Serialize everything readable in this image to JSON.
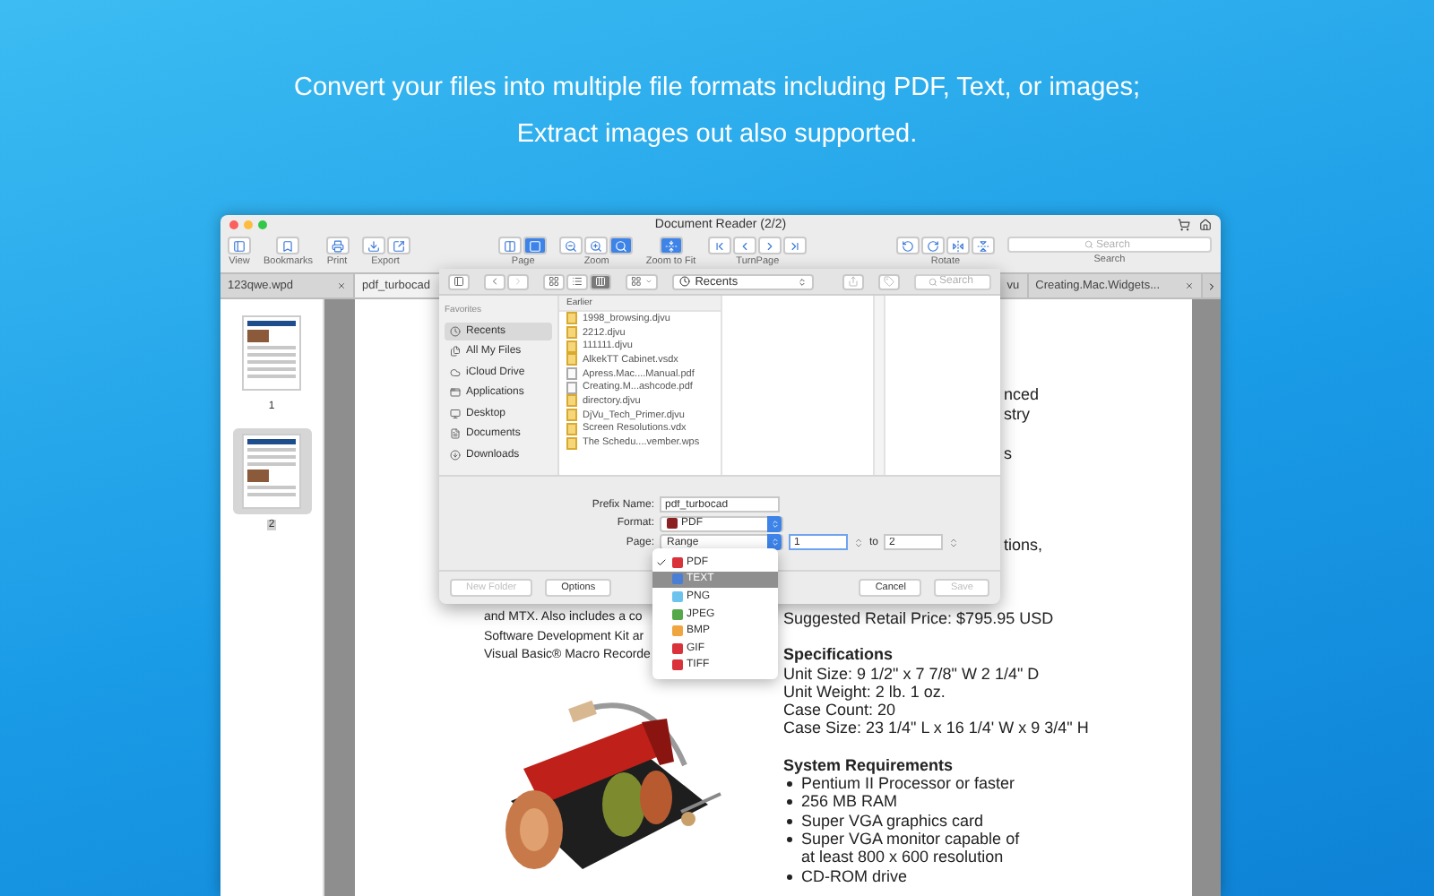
{
  "headline": [
    "Convert your files into multiple file formats including PDF, Text, or images;",
    "Extract images out also supported."
  ],
  "window": {
    "title": "Document Reader (2/2)"
  },
  "toolbar": {
    "groups": [
      {
        "label": "View",
        "buttons": [
          {
            "selected": false
          }
        ]
      },
      {
        "label": "Bookmarks",
        "buttons": [
          {
            "selected": false
          }
        ]
      },
      {
        "label": "Print",
        "buttons": [
          {
            "selected": false
          }
        ]
      },
      {
        "label": "Export",
        "buttons": [
          {
            "selected": false
          },
          {
            "selected": false
          }
        ]
      },
      {
        "label": "Page",
        "buttons": [
          {
            "selected": false
          },
          {
            "selected": true
          }
        ]
      },
      {
        "label": "Zoom",
        "buttons": [
          {
            "selected": false
          },
          {
            "selected": false
          },
          {
            "selected": true
          }
        ]
      },
      {
        "label": "Zoom to Fit",
        "buttons": [
          {
            "selected": true
          }
        ]
      },
      {
        "label": "TurnPage",
        "buttons": [
          {
            "selected": false
          },
          {
            "selected": false
          },
          {
            "selected": false
          },
          {
            "selected": false
          }
        ]
      },
      {
        "label": "Rotate",
        "buttons": [
          {
            "selected": false
          },
          {
            "selected": false
          },
          {
            "selected": false
          },
          {
            "selected": false
          }
        ]
      }
    ],
    "search": {
      "label": "Search",
      "placeholder": "Search"
    }
  },
  "tabs": [
    {
      "label": "123qwe.wpd",
      "selected": false
    },
    {
      "label": "pdf_turbocad",
      "selected": true
    },
    {
      "label": "vu",
      "selected": false
    },
    {
      "label": "Creating.Mac.Widgets...",
      "selected": false
    }
  ],
  "thumbnails": [
    {
      "label": "1",
      "selected": false
    },
    {
      "label": "2",
      "selected": true
    }
  ],
  "document": {
    "fragments": [
      "nced",
      "stry",
      "s",
      "tions,"
    ],
    "left_lines": [
      "and MTX. Also includes a co",
      "Software Development Kit ar",
      "Visual Basic® Macro Recorde"
    ],
    "price": "Suggested Retail Price: $795.95 USD",
    "specs_heading": "Specifications",
    "specs": [
      "Unit Size: 9 1/2\"  x 7 7/8\" W 2 1/4\" D",
      "Unit Weight: 2 lb. 1 oz.",
      "Case Count: 20",
      "Case Size: 23 1/4\" L x 16 1/4' W x 9 3/4\" H"
    ],
    "requirements_heading": "System Requirements",
    "requirements": [
      [
        "Pentium II Processor or faster"
      ],
      [
        "256 MB RAM"
      ],
      [
        "Super VGA graphics card"
      ],
      [
        "Super VGA monitor capable of",
        "at least 800 x 600 resolution"
      ],
      [
        "CD-ROM drive"
      ]
    ]
  },
  "dialog": {
    "toolbar": {
      "views": [
        {
          "selected": false
        },
        {
          "selected": false
        },
        {
          "selected": true
        }
      ],
      "location": "Recents",
      "search": {
        "placeholder": "Search"
      }
    },
    "sidebar": {
      "heading": "Favorites",
      "items": [
        {
          "label": "Recents",
          "selected": true
        },
        {
          "label": "All My Files",
          "selected": false
        },
        {
          "label": "iCloud Drive",
          "selected": false
        },
        {
          "label": "Applications",
          "selected": false
        },
        {
          "label": "Desktop",
          "selected": false
        },
        {
          "label": "Documents",
          "selected": false
        },
        {
          "label": "Downloads",
          "selected": false
        }
      ]
    },
    "list": {
      "heading": "Earlier",
      "files": [
        {
          "name": "1998_browsing.djvu",
          "kind": "image"
        },
        {
          "name": "2212.djvu",
          "kind": "image"
        },
        {
          "name": "111111.djvu",
          "kind": "image"
        },
        {
          "name": "AlkekTT Cabinet.vsdx",
          "kind": "image"
        },
        {
          "name": "Apress.Mac....Manual.pdf",
          "kind": "document"
        },
        {
          "name": "Creating.M...ashcode.pdf",
          "kind": "document"
        },
        {
          "name": "directory.djvu",
          "kind": "image"
        },
        {
          "name": "DjVu_Tech_Primer.djvu",
          "kind": "image"
        },
        {
          "name": "Screen Resolutions.vdx",
          "kind": "image"
        },
        {
          "name": "The Schedu....vember.wps",
          "kind": "image"
        }
      ]
    },
    "form": {
      "prefix": {
        "label": "Prefix Name:",
        "value": "pdf_turbocad"
      },
      "format": {
        "label": "Format:",
        "value": "PDF"
      },
      "page": {
        "label": "Page:",
        "value": "Range",
        "from": "1",
        "to_label": "to",
        "to": "2"
      }
    },
    "buttons": [
      {
        "label": "New Folder",
        "disabled": true
      },
      {
        "label": "Options",
        "disabled": false
      },
      {
        "label": "Cancel",
        "disabled": false
      },
      {
        "label": "Save",
        "disabled": true
      }
    ]
  },
  "format_menu": {
    "items": [
      {
        "label": "PDF",
        "checked": true,
        "selected": false,
        "color": "#d9323a"
      },
      {
        "label": "TEXT",
        "checked": false,
        "selected": true,
        "color": "#4a7fd6"
      },
      {
        "label": "PNG",
        "checked": false,
        "selected": false,
        "color": "#6cc4ee"
      },
      {
        "label": "JPEG",
        "checked": false,
        "selected": false,
        "color": "#55a84a"
      },
      {
        "label": "BMP",
        "checked": false,
        "selected": false,
        "color": "#f0a640"
      },
      {
        "label": "GIF",
        "checked": false,
        "selected": false,
        "color": "#d9323a"
      },
      {
        "label": "TIFF",
        "checked": false,
        "selected": false,
        "color": "#d9323a"
      }
    ]
  }
}
